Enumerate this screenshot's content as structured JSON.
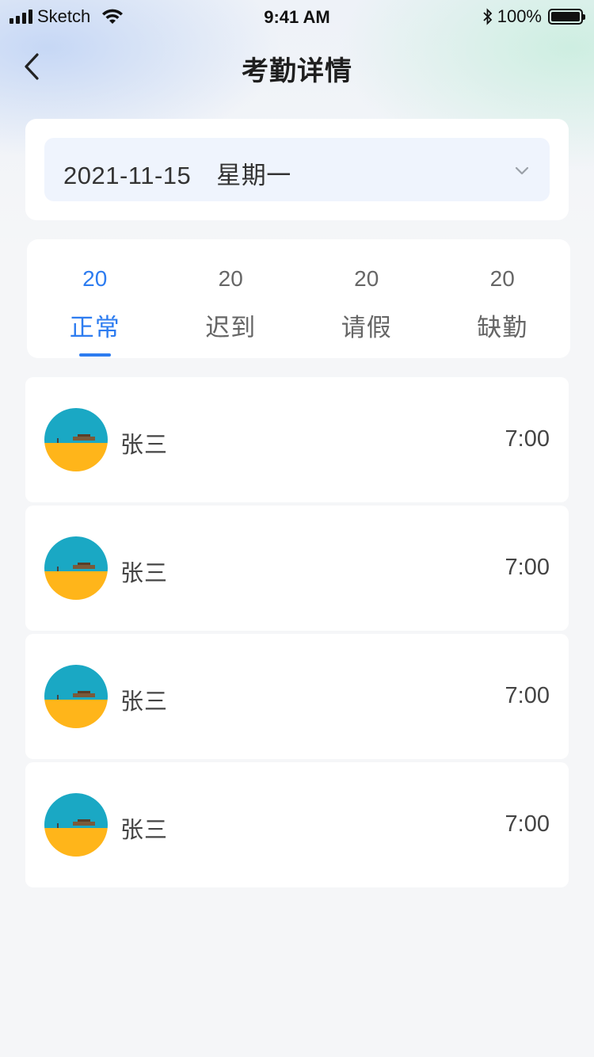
{
  "status_bar": {
    "carrier": "Sketch",
    "time": "9:41 AM",
    "battery": "100%"
  },
  "nav": {
    "title": "考勤详情"
  },
  "date_select": {
    "date": "2021-11-15",
    "weekday": "星期一"
  },
  "tabs": [
    {
      "count": "20",
      "label": "正常",
      "active": true
    },
    {
      "count": "20",
      "label": "迟到",
      "active": false
    },
    {
      "count": "20",
      "label": "请假",
      "active": false
    },
    {
      "count": "20",
      "label": "缺勤",
      "active": false
    }
  ],
  "records": [
    {
      "name": "张三",
      "time": "7:00"
    },
    {
      "name": "张三",
      "time": "7:00"
    },
    {
      "name": "张三",
      "time": "7:00"
    },
    {
      "name": "张三",
      "time": "7:00"
    }
  ],
  "colors": {
    "accent": "#2d7cf0",
    "date_field_bg": "#eff4fd",
    "page_bg": "#f5f6f8",
    "avatar_sky": "#1aa8c4",
    "avatar_sand": "#ffb51a"
  }
}
